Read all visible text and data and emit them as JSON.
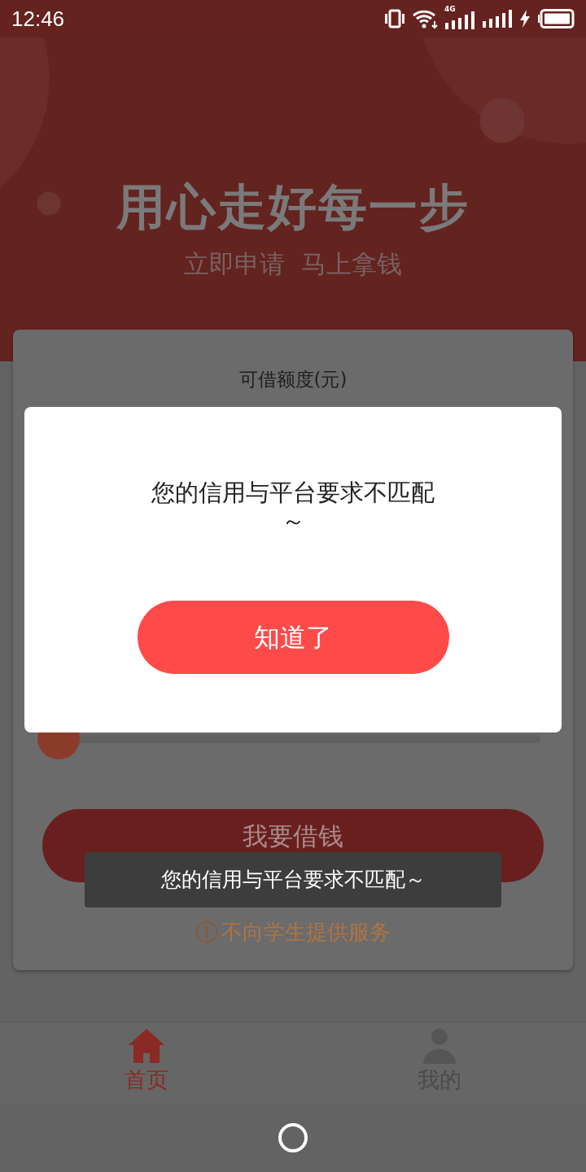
{
  "status_bar": {
    "time": "12:46",
    "network_label": "4G"
  },
  "banner": {
    "title": "用心走好每一步",
    "subtitle": "立即申请  马上拿钱"
  },
  "card": {
    "label": "可借额度(元)",
    "slider": {
      "level": 0
    },
    "button": "我要借钱",
    "notice": "不向学生提供服务"
  },
  "dialog": {
    "message": "您的信用与平台要求不匹配～",
    "button": "知道了"
  },
  "toast": {
    "message": "您的信用与平台要求不匹配～"
  },
  "tabs": [
    {
      "label": "首页",
      "kind": "home",
      "selected": true
    },
    {
      "label": "我的",
      "kind": "profile",
      "selected": false
    }
  ]
}
